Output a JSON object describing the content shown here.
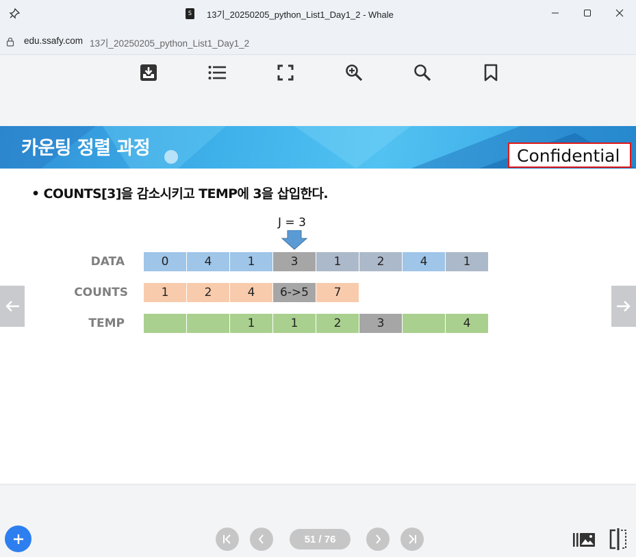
{
  "window": {
    "favicon_text": "S",
    "title": "13기_20250205_python_List1_Day1_2 - Whale"
  },
  "address": {
    "host": "edu.ssafy.com",
    "path": "13기_20250205_python_List1_Day1_2"
  },
  "toolbar": {
    "icons": [
      "download-icon",
      "list-icon",
      "fullscreen-icon",
      "zoom-in-icon",
      "search-icon",
      "bookmark-icon"
    ]
  },
  "slide": {
    "title": "카운팅 정렬 과정",
    "confidential": "Confidential",
    "bullet": "• COUNTS[3]을 감소시키고 TEMP에 3을 삽입한다.",
    "pointer_label": "J = 3",
    "rows": [
      {
        "label": "DATA",
        "cells": [
          {
            "value": "0",
            "color": "#9fc5e8"
          },
          {
            "value": "4",
            "color": "#9fc5e8"
          },
          {
            "value": "1",
            "color": "#9fc5e8"
          },
          {
            "value": "3",
            "color": "#a6a6a6"
          },
          {
            "value": "1",
            "color": "#acb9ca"
          },
          {
            "value": "2",
            "color": "#acb9ca"
          },
          {
            "value": "4",
            "color": "#9fc5e8"
          },
          {
            "value": "1",
            "color": "#acb9ca"
          }
        ]
      },
      {
        "label": "COUNTS",
        "cells": [
          {
            "value": "1",
            "color": "#f8cbad"
          },
          {
            "value": "2",
            "color": "#f8cbad"
          },
          {
            "value": "4",
            "color": "#f8cbad"
          },
          {
            "value": "6->5",
            "color": "#a6a6a6"
          },
          {
            "value": "7",
            "color": "#f8cbad"
          }
        ]
      },
      {
        "label": "TEMP",
        "cells": [
          {
            "value": "",
            "color": "#a9d08e"
          },
          {
            "value": "",
            "color": "#a9d08e"
          },
          {
            "value": "1",
            "color": "#a9d08e"
          },
          {
            "value": "1",
            "color": "#a9d08e"
          },
          {
            "value": "2",
            "color": "#a9d08e"
          },
          {
            "value": "3",
            "color": "#a6a6a6"
          },
          {
            "value": "",
            "color": "#a9d08e"
          },
          {
            "value": "4",
            "color": "#a9d08e"
          }
        ]
      }
    ]
  },
  "pager": {
    "page": "51 / 76"
  },
  "colors": {
    "accent": "#2d7ff0",
    "confidential_border": "#e11818",
    "pointer_arrow": "#5b9bd5"
  }
}
